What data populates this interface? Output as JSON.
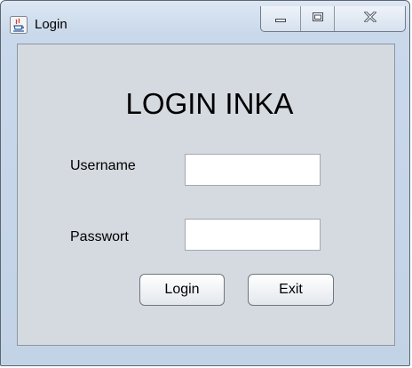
{
  "window": {
    "title": "Login",
    "controls": {
      "minimize": "minimize-icon",
      "maximize": "maximize-icon",
      "close": "close-icon"
    }
  },
  "form": {
    "heading": "LOGIN INKA",
    "username_label": "Username",
    "username_value": "",
    "password_label": "Passwort",
    "password_value": "",
    "login_button": "Login",
    "exit_button": "Exit"
  }
}
